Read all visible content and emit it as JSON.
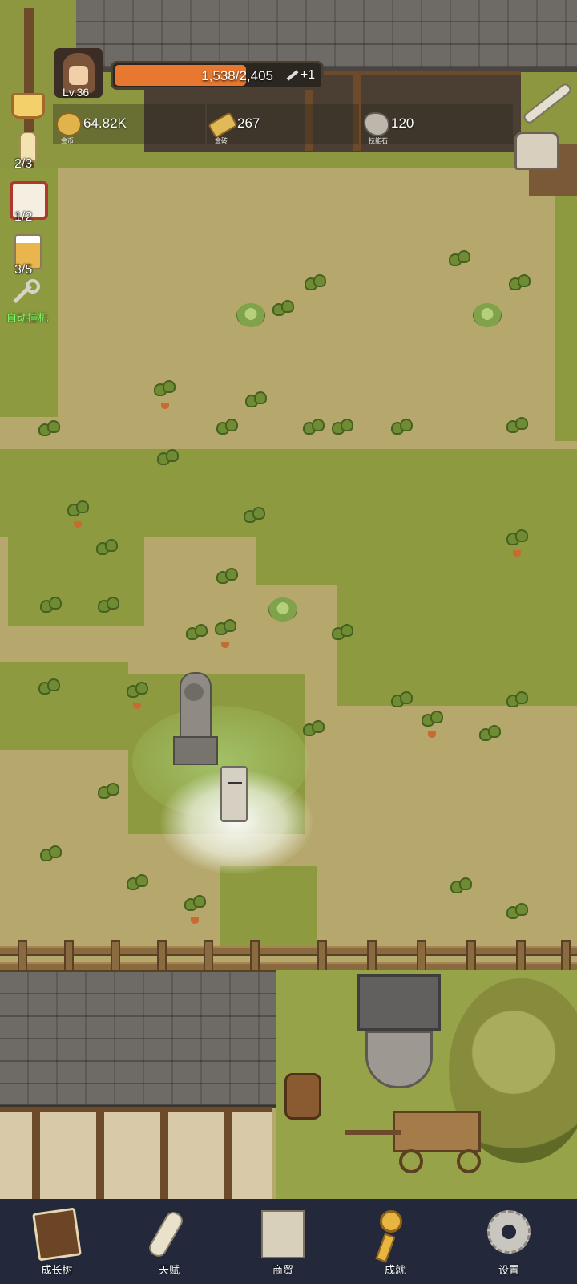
{
  "player": {
    "level": "Lv.36"
  },
  "xp": {
    "text": "1,538/2,405",
    "current": 1538,
    "max": 2405,
    "bonus": "+1"
  },
  "resources": [
    {
      "value": "64.82K",
      "label": "金币",
      "icon": "gold-coin-icon",
      "color": "#e0b44a"
    },
    {
      "value": "267",
      "label": "金砖",
      "icon": "gold-brick-icon",
      "color": "#e2b957"
    },
    {
      "value": "120",
      "label": "技能石",
      "icon": "skill-stone-icon",
      "color": "#bdb6aa"
    }
  ],
  "side_items": [
    {
      "name": "crown",
      "count": ""
    },
    {
      "name": "candle",
      "count": "2/3"
    },
    {
      "name": "dice",
      "count": "1/2"
    },
    {
      "name": "beer",
      "count": "3/5"
    },
    {
      "name": "auto-idle-key",
      "label": "自动挂机"
    }
  ],
  "nav": [
    {
      "label": "成长树",
      "icon": "book-icon"
    },
    {
      "label": "天赋",
      "icon": "scroll-icon"
    },
    {
      "label": "商贸",
      "icon": "map-icon"
    },
    {
      "label": "成就",
      "icon": "key-icon"
    },
    {
      "label": "设置",
      "icon": "gear-icon"
    }
  ],
  "colors": {
    "xp_fill": "#e8772f",
    "nav_bg": "#23293a",
    "idle_label": "#7cff6a"
  }
}
